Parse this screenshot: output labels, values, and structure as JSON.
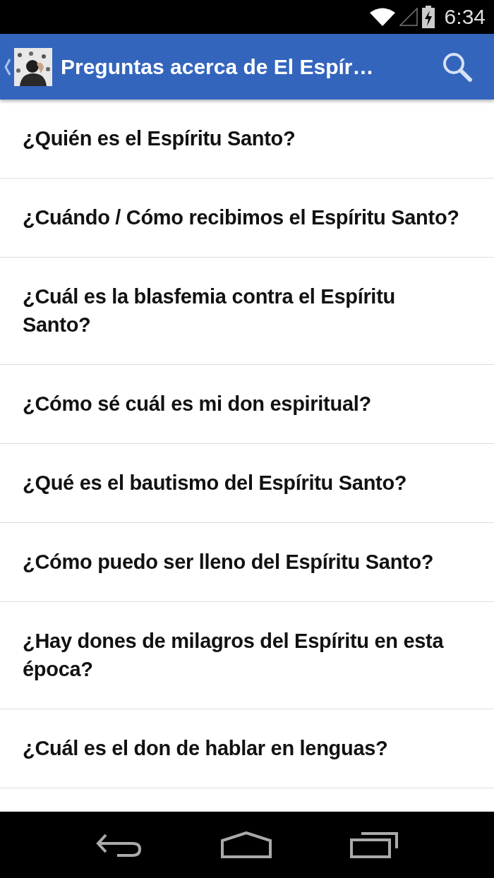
{
  "status_bar": {
    "time": "6:34"
  },
  "app_bar": {
    "title": "Preguntas acerca de El Espír…"
  },
  "questions": [
    "¿Quién es el Espíritu Santo?",
    "¿Cuándo / Cómo recibimos el Espíritu Santo?",
    "¿Cuál es la blasfemia contra el Espíritu Santo?",
    "¿Cómo sé cuál es mi don espiritual?",
    "¿Qué es el bautismo del Espíritu Santo?",
    "¿Cómo puedo ser lleno del Espíritu Santo?",
    "¿Hay dones de milagros del Espíritu en esta época?",
    "¿Cuál es el don de hablar en lenguas?"
  ]
}
